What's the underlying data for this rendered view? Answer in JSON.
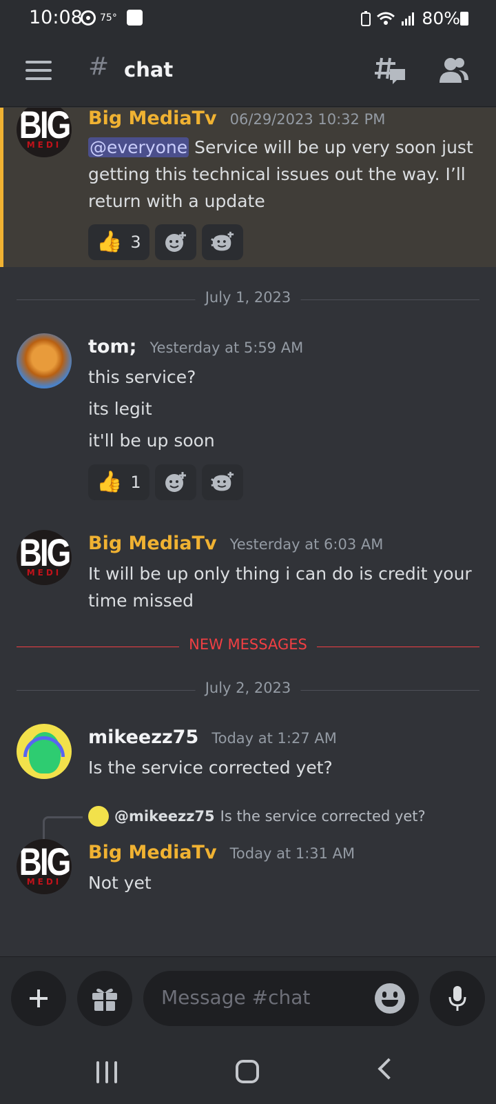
{
  "status_bar": {
    "time": "10:08",
    "temperature": "75°",
    "battery": "80%"
  },
  "header": {
    "hash": "#",
    "channel": "chat"
  },
  "messages": [
    {
      "author": "Big MediaTv",
      "timestamp": "06/29/2023 10:32 PM",
      "mention": "@everyone",
      "text_lines": [
        "Service will be up very soon just",
        "getting this technical issues out the way. I’ll",
        "return with a update"
      ],
      "reactions": [
        {
          "emoji": "👍",
          "count": "3"
        }
      ]
    },
    {
      "author": "tom;",
      "timestamp": "Yesterday at 5:59 AM",
      "lines": [
        "this service?",
        "its legit",
        "it'll be up soon"
      ],
      "reactions": [
        {
          "emoji": "👍",
          "count": "1"
        }
      ]
    },
    {
      "author": "Big MediaTv",
      "timestamp": "Yesterday at 6:03 AM",
      "text_lines": [
        "It will be up only thing i can do is credit your",
        "time missed"
      ]
    },
    {
      "author": "mikeezz75",
      "timestamp": "Today at 1:27 AM",
      "text": "Is the service corrected yet?"
    },
    {
      "reply_to": {
        "name": "@mikeezz75",
        "text": "Is the service corrected yet?"
      },
      "author": "Big MediaTv",
      "timestamp": "Today at 1:31 AM",
      "text": "Not yet"
    }
  ],
  "dividers": {
    "date1": "July 1, 2023",
    "new_messages": "NEW MESSAGES",
    "date2": "July 2, 2023"
  },
  "avatar": {
    "big_word": "BIG",
    "big_sub": "MEDI"
  },
  "composer": {
    "placeholder": "Message #chat"
  },
  "colors": {
    "background": "#313338",
    "bar": "#2b2d31",
    "author_yellow": "#f0b232",
    "new_messages_red": "#f23f43",
    "mention_bg": "#4b4f8c"
  }
}
